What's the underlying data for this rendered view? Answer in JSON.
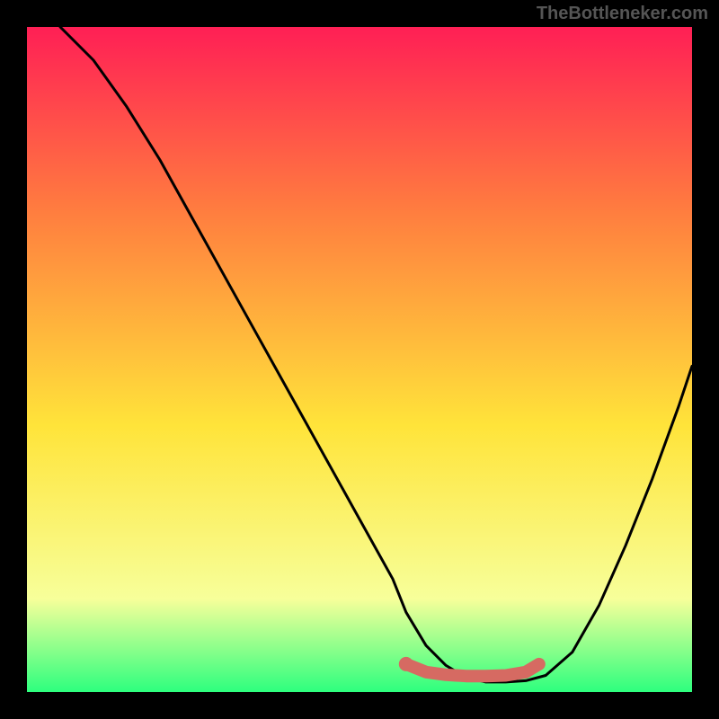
{
  "attribution": "TheBottleneker.com",
  "colors": {
    "bg_black": "#000000",
    "curve": "#000000",
    "highlight": "#d66a62",
    "grad_top": "#ff1f55",
    "grad_mid_upper": "#ff7e3f",
    "grad_mid": "#ffe43a",
    "grad_lower": "#f7ff9a",
    "grad_bottom": "#2dff7e"
  },
  "chart_data": {
    "type": "line",
    "title": "",
    "xlabel": "",
    "ylabel": "",
    "xlim": [
      0,
      100
    ],
    "ylim": [
      0,
      100
    ],
    "series": [
      {
        "name": "curve",
        "x": [
          5,
          10,
          15,
          20,
          25,
          30,
          35,
          40,
          45,
          50,
          55,
          57,
          60,
          63,
          66,
          69,
          72,
          75,
          78,
          82,
          86,
          90,
          94,
          98,
          100
        ],
        "y": [
          100,
          95,
          88,
          80,
          71,
          62,
          53,
          44,
          35,
          26,
          17,
          12,
          7,
          4,
          2.2,
          1.5,
          1.5,
          1.7,
          2.5,
          6,
          13,
          22,
          32,
          43,
          49
        ]
      }
    ],
    "highlight_segment": {
      "x": [
        57,
        60,
        63,
        66,
        69,
        72,
        75,
        77
      ],
      "y": [
        4.2,
        3.0,
        2.6,
        2.4,
        2.4,
        2.5,
        3.0,
        4.2
      ]
    }
  }
}
